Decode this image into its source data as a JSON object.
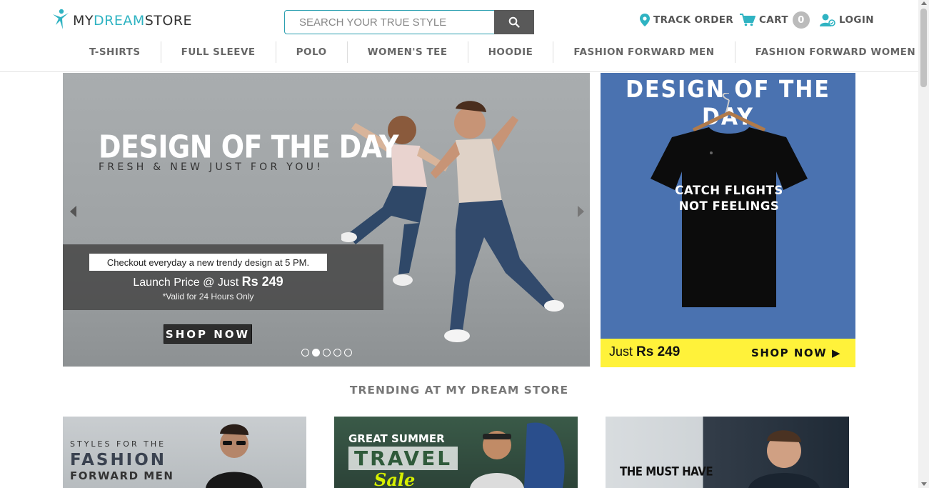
{
  "header": {
    "logo": {
      "my": "MY",
      "dream": "DREAM",
      "store": "STORE"
    },
    "search": {
      "placeholder": "SEARCH YOUR TRUE STYLE",
      "icon": "search-icon"
    },
    "track_order": "TRACK ORDER",
    "cart": {
      "label": "CART",
      "count": "0"
    },
    "login": "LOGIN",
    "categories": [
      "T-SHIRTS",
      "FULL SLEEVE",
      "POLO",
      "WOMEN'S TEE",
      "HOODIE",
      "FASHION FORWARD MEN",
      "FASHION FORWARD WOMEN"
    ]
  },
  "hero": {
    "title": "DESIGN OF THE DAY",
    "subtitle": "FRESH & NEW JUST FOR YOU!",
    "checkout": "Checkout everyday a new trendy design at 5 PM.",
    "price_prefix": "Launch Price @ Just ",
    "price": "Rs 249",
    "valid": "*Valid for 24 Hours Only",
    "cta": "SHOP NOW",
    "slides": 5,
    "active_slide": 2
  },
  "promo": {
    "title": "DESIGN OF THE DAY",
    "shirt_line1": "CATCH FLIGHTS",
    "shirt_line2": "NOT FEELINGS",
    "just": "Just ",
    "price": "Rs 249",
    "cta": "SHOP NOW"
  },
  "trending": {
    "heading": "TRENDING AT MY DREAM STORE"
  },
  "tiles": [
    {
      "line1": "STYLES FOR THE",
      "line2": "FASHION",
      "line3": "FORWARD MEN"
    },
    {
      "line1": "GREAT SUMMER",
      "line2": "TRAVEL",
      "line3": "Sale"
    },
    {
      "line1": "THE MUST HAVE"
    }
  ],
  "colors": {
    "accent": "#2fb3c2",
    "promo_blue": "#4a72b0",
    "promo_yellow": "#fff23a",
    "search_button": "#595959"
  }
}
